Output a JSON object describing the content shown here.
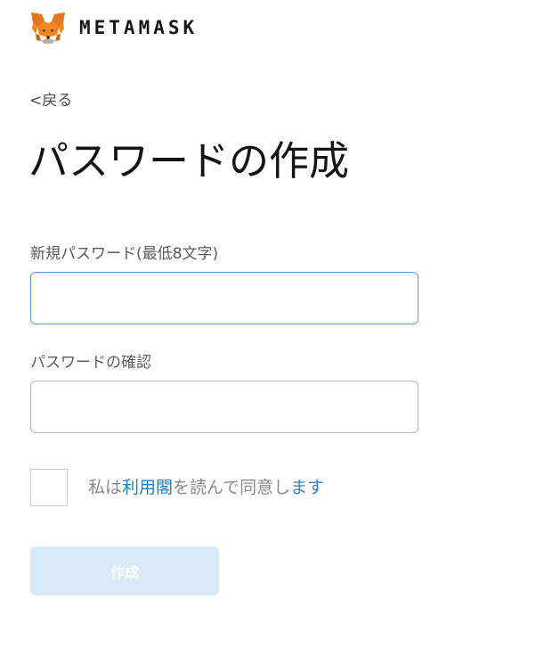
{
  "header": {
    "brand": "METAMASK",
    "logo_icon": "metamask-fox-icon"
  },
  "nav": {
    "back_label": "<戻る"
  },
  "page": {
    "title": "パスワードの作成"
  },
  "form": {
    "new_password": {
      "label": "新規パスワード(最低8文字)",
      "value": "",
      "placeholder": ""
    },
    "confirm_password": {
      "label": "パスワードの確認",
      "value": "",
      "placeholder": ""
    },
    "agreement": {
      "checked": false,
      "prefix": "私は",
      "terms_link": "利用閣",
      "middle": "を読んで同意し",
      "suffix": "ます"
    },
    "submit_label": "作成",
    "submit_enabled": false
  },
  "colors": {
    "accent": "#1f7fc4",
    "focus_border": "#5a9bd8",
    "button_disabled_bg": "#d8eaf8"
  }
}
